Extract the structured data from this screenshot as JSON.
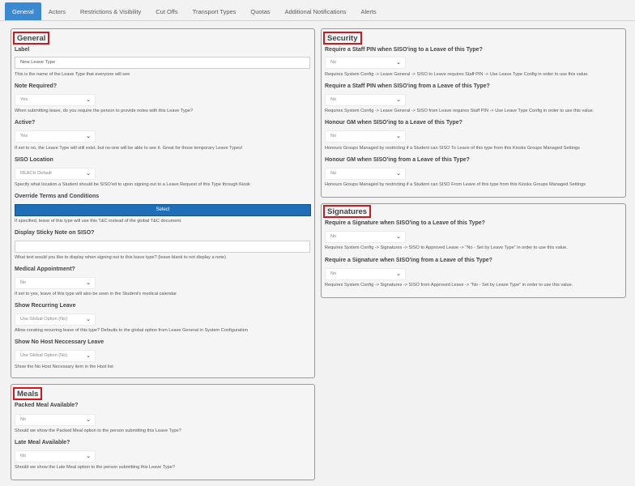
{
  "tabs": [
    {
      "label": "General"
    },
    {
      "label": "Actors"
    },
    {
      "label": "Restrictions & Visibility"
    },
    {
      "label": "Cut Offs"
    },
    {
      "label": "Transport Types"
    },
    {
      "label": "Quotas"
    },
    {
      "label": "Additional Notifications"
    },
    {
      "label": "Alerts"
    }
  ],
  "general": {
    "title": "General",
    "label_field": {
      "label": "Label",
      "value": "New Leave Type",
      "help": "This is the name of the Leave Type that everyone will see"
    },
    "note_required": {
      "label": "Note Required?",
      "value": "Yes",
      "help": "When submitting leave, do you require the person to provide notes with this Leave Type?"
    },
    "active": {
      "label": "Active?",
      "value": "Yes",
      "help": "If set to no, the Leave Type will still exist, but no-one will be able to see it. Great for those temporary Leave Types!"
    },
    "siso_location": {
      "label": "SISO Location",
      "value": "REACH Default",
      "help": "Specify what location a Student should be SISO'ed to upon signing out to a Leave Request of this Type through Kiosk"
    },
    "override_terms": {
      "label": "Override Terms and Conditions",
      "button": "Select",
      "help": "If specified, leave of this type will use this T&C instead of the global T&C document."
    },
    "sticky_note": {
      "label": "Display Sticky Note on SISO?",
      "value": "",
      "help": "What text would you like to display when signing out to this leave type? (leave blank to not display a note)"
    },
    "medical": {
      "label": "Medical Appointment?",
      "value": "No",
      "help": "If set to yes, leave of this type will also be seen in the Student's medical calendar"
    },
    "recurring": {
      "label": "Show Recurring Leave",
      "value": "Use Global Option (No)",
      "help": "Allow creating recurring leave of this type? Defaults to the global option from Leave General in System Configuration"
    },
    "no_host": {
      "label": "Show No Host Neccessary Leave",
      "value": "Use Global Option (No)",
      "help": "Show the No Host Necessary item in the Host list"
    }
  },
  "meals": {
    "title": "Meals",
    "packed": {
      "label": "Packed Meal Available?",
      "value": "No",
      "help": "Should we show the Packed Meal option to the person submitting this Leave Type?"
    },
    "late": {
      "label": "Late Meal Available?",
      "value": "No",
      "help": "Should we show the Late Meal option to the person submitting this Leave Type?"
    }
  },
  "security": {
    "title": "Security",
    "pin_to": {
      "label": "Require a Staff PIN when SISO'ing to a Leave of this Type?",
      "value": "No",
      "help": "Requires System Config -> Leave General -> SISO to Leave requires Staff PIN -> Use Leave Type Config in order to use this value."
    },
    "pin_from": {
      "label": "Require a Staff PIN when SISO'ing from a Leave of this Type?",
      "value": "No",
      "help": "Requires System Config -> Leave General -> SISO from Leave requires Staff PIN -> Use Leave Type Config in order to use this value."
    },
    "gm_to": {
      "label": "Honour GM when SISO'ing to a Leave of this Type?",
      "value": "No",
      "help": "Honours Groups Managed by restricting if a Student can SISO To Leave of this type from this Kiosks Groups Managed Settings"
    },
    "gm_from": {
      "label": "Honour GM when SISO'ing from a Leave of this Type?",
      "value": "No",
      "help": "Honours Groups Managed by restricting if a Student can SISO From Leave of this type from this Kiosks Groups Managed Settings"
    }
  },
  "signatures": {
    "title": "Signatures",
    "sig_to": {
      "label": "Require a Signature when SISO'ing to a Leave of this Type?",
      "value": "No",
      "help": "Requires System Config -> Signatures -> SISO to Approved Leave -> \"No - Set by Leave Type\" in order to use this value."
    },
    "sig_from": {
      "label": "Require a Signature when SISO'ing from a Leave of this Type?",
      "value": "No",
      "help": "Requires System Config -> Signatures -> SISO from Approved Leave -> \"No - Set by Leave Type\" in order to use this value."
    }
  },
  "icons": {
    "chevron": "chevron-down-icon"
  },
  "colors": {
    "tab_active": "#3b8ad1",
    "select_button": "#1f6fb8",
    "title_border": "#d8141c"
  }
}
